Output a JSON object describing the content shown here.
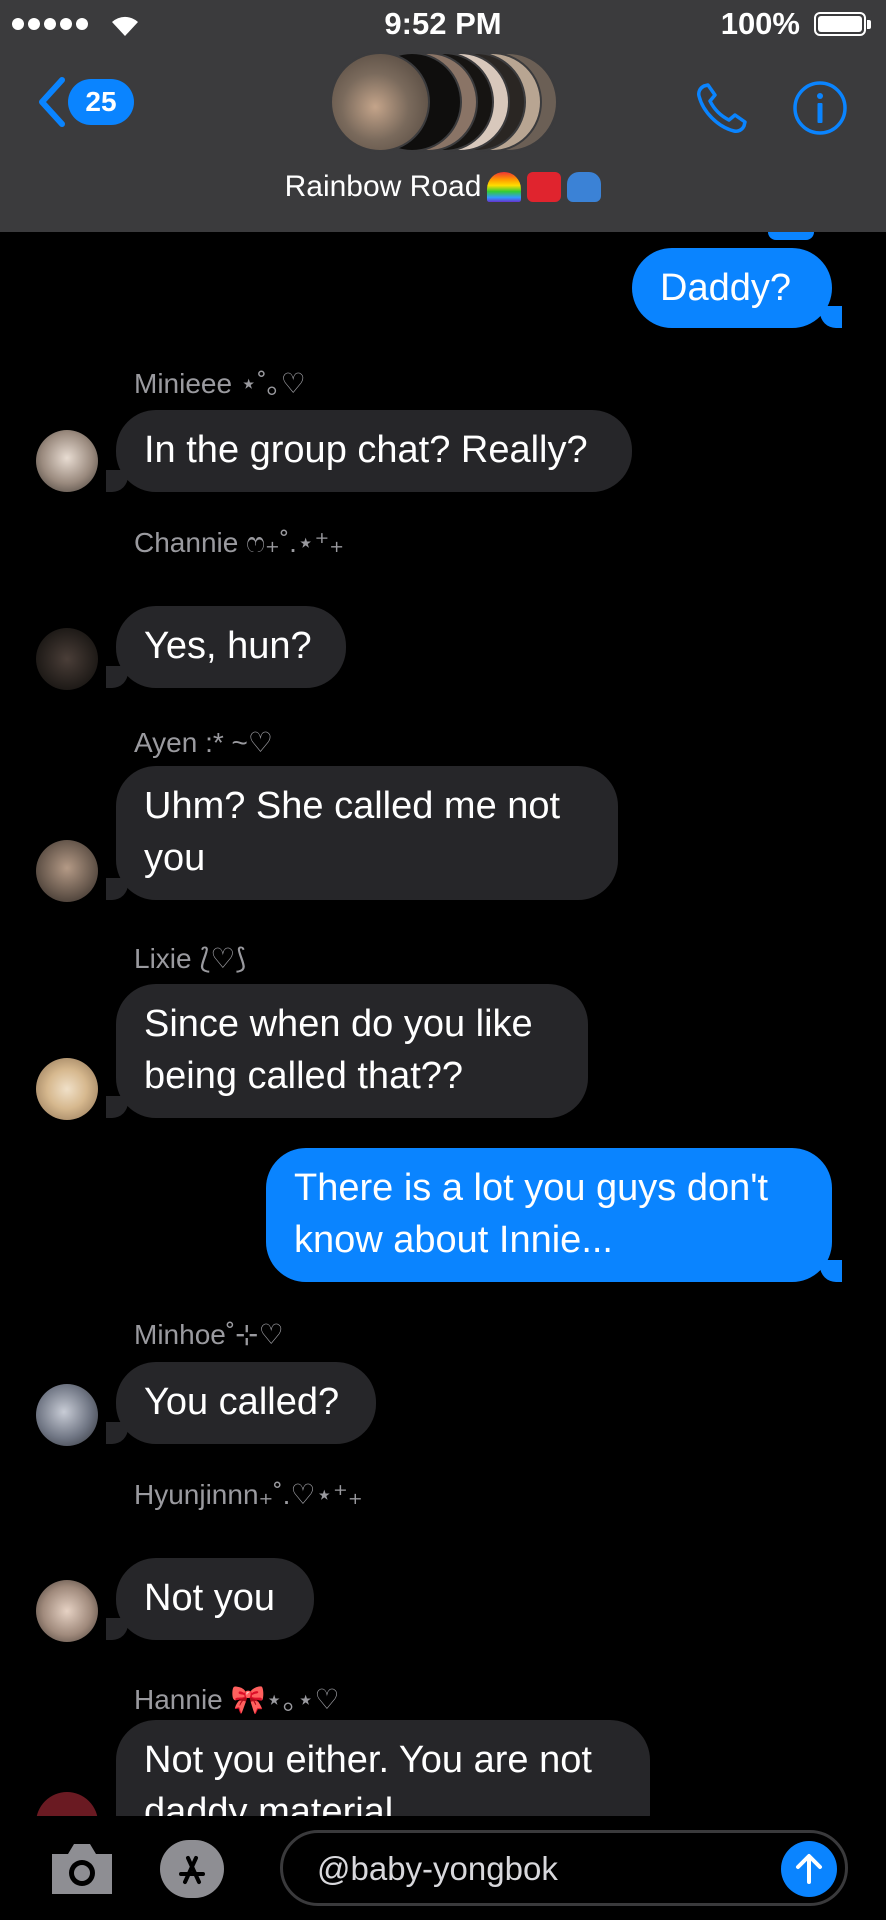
{
  "status": {
    "time": "9:52 PM",
    "battery": "100%",
    "signal_dots": 5
  },
  "header": {
    "back_count": "25",
    "group_name": "Rainbow Road",
    "group_emojis": [
      "rainbow-emoji",
      "anger-emoji",
      "car-emoji"
    ],
    "icons": [
      "back-chevron-icon",
      "phone-icon",
      "info-icon"
    ]
  },
  "messages": [
    {
      "dir": "out",
      "text": "Daddy?"
    },
    {
      "dir": "in",
      "sender": "Minieee ⋆˚｡♡",
      "text": "In the group chat? Really?"
    },
    {
      "dir": "in",
      "sender": "Channie ෆ₊˚.⋆⁺₊",
      "text": "Yes, hun?"
    },
    {
      "dir": "in",
      "sender": "Ayen :* ~♡",
      "text_line1": "Uhm? She called me not",
      "text_line2": "you"
    },
    {
      "dir": "in",
      "sender": "Lixie ⟅♡⟆",
      "text_line1": "Since when do you like",
      "text_line2": "being called that??"
    },
    {
      "dir": "out",
      "text_line1": "There is a lot you guys don't",
      "text_line2": "know about Innie..."
    },
    {
      "dir": "in",
      "sender": "Minhoe˚⊹♡",
      "text": "You called?"
    },
    {
      "dir": "in",
      "sender": "Hyunjinnn₊˚.♡⋆⁺₊",
      "text": "Not you"
    },
    {
      "dir": "in",
      "sender": "Hannie 🎀⋆｡⋆♡",
      "text_line1": "Not you either. You are not",
      "text_line2": "daddy material"
    }
  ],
  "input": {
    "value": "@baby-yongbok",
    "icons": [
      "camera-icon",
      "app-store-icon",
      "send-arrow-icon"
    ]
  },
  "colors": {
    "accent": "#0a84ff",
    "header_bg": "#3b3b3d",
    "incoming_bubble": "#262629",
    "background": "#000000"
  }
}
